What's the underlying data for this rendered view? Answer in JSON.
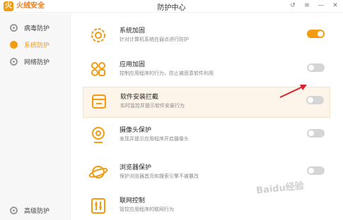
{
  "app": {
    "name": "火绒安全",
    "window_title": "防护中心"
  },
  "window_controls": [
    "↺",
    "≡",
    "—",
    "✕"
  ],
  "sidebar": {
    "items": [
      {
        "label": "病毒防护",
        "icon": "virus-protection-icon",
        "active": false
      },
      {
        "label": "系统防护",
        "icon": "system-protection-icon",
        "active": true
      },
      {
        "label": "网络防护",
        "icon": "network-protection-icon",
        "active": false
      }
    ],
    "bottom_item": {
      "label": "高级防护",
      "icon": "advanced-protection-icon"
    }
  },
  "protections": [
    {
      "title": "系统加固",
      "desc": "针对计算机系统在弱点进行防护",
      "enabled": true,
      "icon": "gear-shield-icon"
    },
    {
      "title": "应用加固",
      "desc": "控制应用程序的行为，防止被恶意软件利用",
      "enabled": false,
      "icon": "apps-grid-icon"
    },
    {
      "title": "软件安装拦截",
      "desc": "实时监控并提示软件安装行为",
      "enabled": false,
      "icon": "install-block-icon"
    },
    {
      "title": "摄像头保护",
      "desc": "发现并提示应用程序开启摄像头",
      "enabled": false,
      "icon": "camera-icon"
    },
    {
      "title": "浏览器保护",
      "desc": "保护浏览器首页和搜索引擎不被篡改",
      "enabled": false,
      "icon": "browser-planet-icon"
    },
    {
      "title": "联网控制",
      "desc": "管控应用程序的联网行为",
      "enabled": false,
      "icon": "network-control-icon"
    }
  ],
  "colors": {
    "accent": "#f39c12",
    "toggle_off": "#d5d5d5",
    "arrow": "#d9232e"
  },
  "watermark": "Baidu经验"
}
